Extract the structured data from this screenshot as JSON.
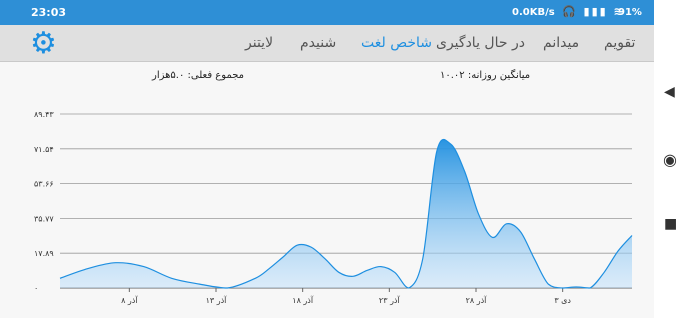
{
  "status": {
    "time": "23:03",
    "net_speed": "0.0KB/s",
    "battery": "91%",
    "icons": "🎧 ▮▮▮ ≋"
  },
  "tabs": [
    {
      "label": "تقویم",
      "active": false
    },
    {
      "label": "میدانم",
      "active": false
    },
    {
      "label": "در حال یادگیری",
      "active": false
    },
    {
      "label": "شاخص لغت",
      "active": true
    },
    {
      "label": "شنیدم",
      "active": false
    },
    {
      "label": "لایتنر",
      "active": false
    }
  ],
  "summary": {
    "daily_average": "میانگین روزانه: ۱۰.۰۲",
    "current_total": "مجموع فعلی: ۵.۰هزار"
  },
  "icons": {
    "settings": "gear-icon",
    "back": "back-icon",
    "home": "home-icon",
    "recents": "recents-icon"
  },
  "colors": {
    "accent": "#1e8fe0",
    "status_bar": "#2e8fd6"
  },
  "chart_data": {
    "type": "area",
    "ylim": [
      0,
      89.43
    ],
    "y_ticks": [
      "۰",
      "۱۷.۸۹",
      "۳۵.۷۷",
      "۵۳.۶۶",
      "۷۱.۵۴",
      "۸۹.۴۳"
    ],
    "x_ticks": [
      "۸ آذر",
      "۱۳ آذر",
      "۱۸ آذر",
      "۲۳ آذر",
      "۲۸ آذر",
      "۳ دی"
    ],
    "x_tick_days": [
      4,
      9,
      14,
      19,
      24,
      29
    ],
    "x_range": [
      0,
      33
    ],
    "points": [
      [
        0,
        5
      ],
      [
        2,
        10
      ],
      [
        4,
        13
      ],
      [
        6,
        11
      ],
      [
        8,
        5
      ],
      [
        10,
        2
      ],
      [
        12,
        0
      ],
      [
        14,
        5
      ],
      [
        15,
        10
      ],
      [
        16,
        16
      ],
      [
        17,
        22
      ],
      [
        18,
        21
      ],
      [
        19,
        15
      ],
      [
        20,
        8
      ],
      [
        21,
        6
      ],
      [
        22,
        9
      ],
      [
        23,
        11
      ],
      [
        24,
        8
      ],
      [
        25,
        0
      ],
      [
        26,
        15
      ],
      [
        27,
        70
      ],
      [
        28,
        74
      ],
      [
        29,
        60
      ],
      [
        30,
        38
      ],
      [
        31,
        26
      ],
      [
        32,
        33
      ],
      [
        33,
        29
      ],
      [
        34,
        15
      ],
      [
        35,
        2
      ],
      [
        36,
        0
      ],
      [
        37,
        0.5
      ],
      [
        38,
        0
      ],
      [
        39,
        8
      ],
      [
        40,
        19
      ],
      [
        41,
        27
      ]
    ],
    "grid": true
  }
}
